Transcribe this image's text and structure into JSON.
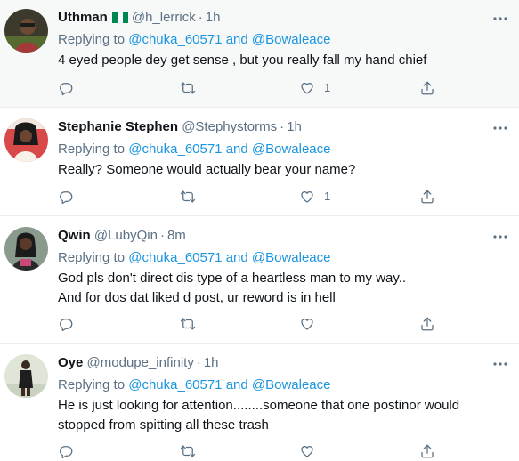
{
  "colors": {
    "mention": "#1b95e0",
    "muted": "#5b7083",
    "text": "#0f1419",
    "divider": "#ebeef0"
  },
  "tweets": [
    {
      "name": "Uthman",
      "flag_icon": "nigeria-flag-icon",
      "handle": "@h_lerrick",
      "dot": "·",
      "time": "1h",
      "replying_prefix": "Replying to",
      "mentions": "@chuka_60571 and @Bowaleace",
      "text": "4 eyed people dey get sense , but you really fall my hand chief",
      "like_count": "1"
    },
    {
      "name": "Stephanie Stephen",
      "handle": "@Stephystorms",
      "dot": "·",
      "time": "1h",
      "replying_prefix": "Replying to",
      "mentions": "@chuka_60571 and @Bowaleace",
      "text": "Really? Someone would actually bear your name?",
      "like_count": "1"
    },
    {
      "name": "Qwin",
      "handle": "@LubyQin",
      "dot": "·",
      "time": "8m",
      "replying_prefix": "Replying to",
      "mentions": "@chuka_60571 and @Bowaleace",
      "text": "God pls don't direct dis type of a heartless man to my way..\nAnd for dos dat liked d post, ur reword is in hell",
      "like_count": ""
    },
    {
      "name": "Oye",
      "handle": "@modupe_infinity",
      "dot": "·",
      "time": "1h",
      "replying_prefix": "Replying to",
      "mentions": "@chuka_60571 and @Bowaleace",
      "text": "He is just looking for attention........someone that one postinor would\nstopped from spitting all these trash",
      "like_count": ""
    }
  ]
}
